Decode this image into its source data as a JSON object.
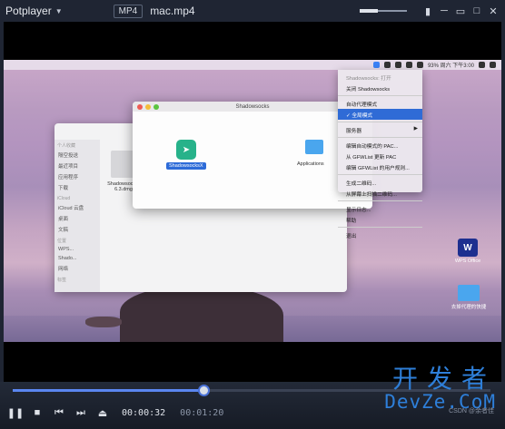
{
  "player": {
    "app_name": "Potplayer",
    "format_badge": "MP4",
    "file_name": "mac.mp4"
  },
  "window_controls": {
    "icons": [
      "pin-icon",
      "minimize-icon",
      "restore-icon",
      "maximize-icon",
      "close-icon"
    ]
  },
  "playback": {
    "current_time": "00:00:32",
    "total_time": "00:01:20",
    "progress_percent": 40
  },
  "mac_frame": {
    "menubar_right": "93%  周六 下午3:00",
    "shadowsocks_window_title": "Shadowsocks",
    "app_label": "ShadowsocksX",
    "folder_label": "Applications",
    "finder_file_label": "Shadowsocks-\n6.3.dmg",
    "finder_sidebar": {
      "favorites_head": "个人收藏",
      "favorites": [
        "隔空投送",
        "最近项目",
        "应用程序",
        "下载"
      ],
      "icloud_head": "iCloud",
      "icloud": [
        "iCloud 云盘",
        "桌面",
        "文稿"
      ],
      "locations_head": "位置",
      "locations": [
        "WPS...",
        "Shado...",
        "网络"
      ],
      "tags_head": "标签"
    },
    "dropdown": [
      {
        "label": "Shadowsocks: 打开",
        "style": "dim"
      },
      {
        "label": "关闭 Shadowsocks",
        "style": "normal"
      },
      {
        "sep": true
      },
      {
        "label": "自动代理模式",
        "style": "normal"
      },
      {
        "label": "✓ 全局模式",
        "style": "sel"
      },
      {
        "sep": true
      },
      {
        "label": "服务器",
        "style": "normal",
        "submenu": true
      },
      {
        "sep": true
      },
      {
        "label": "编辑自动模式的 PAC...",
        "style": "normal"
      },
      {
        "label": "从 GFWList 更新 PAC",
        "style": "normal"
      },
      {
        "label": "编辑 GFWList 的用户规则...",
        "style": "normal"
      },
      {
        "sep": true
      },
      {
        "label": "生成二维码...",
        "style": "normal"
      },
      {
        "label": "从屏幕上扫描二维码...",
        "style": "normal"
      },
      {
        "sep": true
      },
      {
        "label": "显示日志...",
        "style": "normal"
      },
      {
        "label": "帮助",
        "style": "normal"
      },
      {
        "sep": true
      },
      {
        "label": "退出",
        "style": "normal"
      }
    ],
    "desktop_icons": {
      "wps": "WPS Office",
      "folder": "去掉代理的快捷"
    }
  },
  "watermark": {
    "cn": "开发者",
    "en": "DevZe.CoM",
    "small": "CSDN @余者佳"
  },
  "colors": {
    "accent": "#5a86f0",
    "watermark": "#2e7fd9",
    "chrome": "#1f2533"
  }
}
